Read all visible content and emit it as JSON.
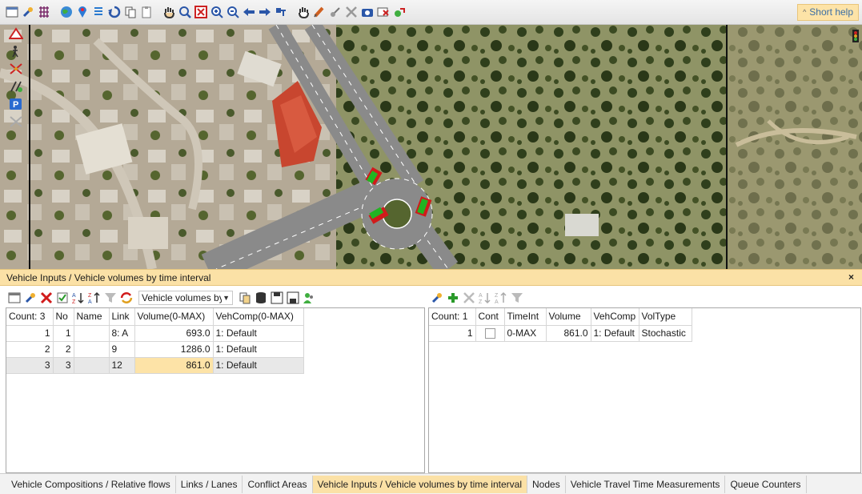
{
  "toolbar": {
    "short_help_label": "Short help",
    "icons": [
      "window-menu-icon",
      "wrench-grid-icon",
      "globe-icon",
      "color-pin-icon",
      "list-icon",
      "undo-icon",
      "copy-icon",
      "paste-icon",
      "pan-hand-icon",
      "zoom-select-icon",
      "zoom-fit-icon",
      "zoom-in-icon",
      "zoom-out-icon",
      "back-icon",
      "forward-icon",
      "network-icon",
      "select-hand-icon",
      "edit-link-icon",
      "node-icon",
      "cross-icon",
      "camera-icon",
      "screenshot-icon",
      "3d-icon"
    ]
  },
  "map": {
    "left_tools": [
      "conflict-areas-icon",
      "pedestrian-icon",
      "routes-icon",
      "vehicle-inputs-icon",
      "parking-icon",
      "measurement-icon"
    ]
  },
  "panel": {
    "title": "Vehicle Inputs / Vehicle volumes by time interval",
    "close_label": "×"
  },
  "left_grid": {
    "combo_value": "Vehicle volumes by",
    "columns": [
      "Count: 3",
      "No",
      "Name",
      "Link",
      "Volume(0-MAX)",
      "VehComp(0-MAX)"
    ],
    "rows": [
      {
        "row": "1",
        "no": "1",
        "name": "",
        "link": "8: A",
        "volume": "693.0",
        "vehcomp": "1: Default"
      },
      {
        "row": "2",
        "no": "2",
        "name": "",
        "link": "9",
        "volume": "1286.0",
        "vehcomp": "1: Default"
      },
      {
        "row": "3",
        "no": "3",
        "name": "",
        "link": "12",
        "volume": "861.0",
        "vehcomp": "1: Default"
      }
    ]
  },
  "right_grid": {
    "columns": [
      "Count: 1",
      "Cont",
      "TimeInt",
      "Volume",
      "VehComp",
      "VolType"
    ],
    "rows": [
      {
        "row": "1",
        "timeint": "0-MAX",
        "volume": "861.0",
        "vehcomp": "1: Default",
        "voltype": "Stochastic"
      }
    ]
  },
  "tabs": [
    {
      "label": "Vehicle Compositions / Relative flows",
      "active": false
    },
    {
      "label": "Links / Lanes",
      "active": false
    },
    {
      "label": "Conflict Areas",
      "active": false
    },
    {
      "label": "Vehicle Inputs / Vehicle volumes by time interval",
      "active": true
    },
    {
      "label": "Nodes",
      "active": false
    },
    {
      "label": "Vehicle Travel Time Measurements",
      "active": false
    },
    {
      "label": "Queue Counters",
      "active": false
    }
  ],
  "colors": {
    "accent": "#fbe1a6",
    "road": "#8a8a8a",
    "green_marker": "#22b422",
    "red_marker": "#d11b1b",
    "roof": "#c8462f"
  }
}
